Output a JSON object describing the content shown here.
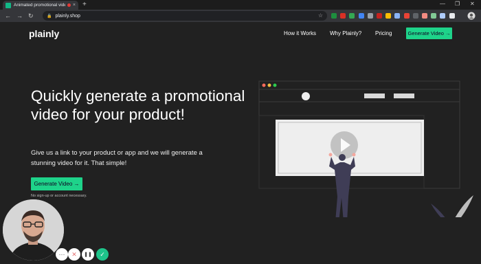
{
  "browser": {
    "tab_title": "Animated promotional video",
    "tab_close": "×",
    "new_tab": "+",
    "back": "←",
    "forward": "→",
    "reload": "↻",
    "url": "plainly.shop",
    "window_min": "—",
    "window_max": "❐",
    "window_close": "✕",
    "extension_colors": [
      "#1e8e3e",
      "#d93025",
      "#34a853",
      "#4285f4",
      "#9aa0a6",
      "#c5221f",
      "#fbbc04",
      "#8ab4f8",
      "#ea4335",
      "#5f6368",
      "#f28b82",
      "#81c995",
      "#aecbfa",
      "#e8eaed"
    ]
  },
  "site": {
    "logo": "plainly",
    "nav": [
      "How it Works",
      "Why Plainly?",
      "Pricing"
    ],
    "cta_top": "Generate Video →",
    "headline": "Quickly generate a promotional video for your product!",
    "subtext": "Give us a link to your product or app and we will generate a stunning video for it. That simple!",
    "cta_main": "Generate Video →",
    "note": "No sign-up or account necessary."
  },
  "recorder": {
    "controls": [
      {
        "icon": "more-icon",
        "glyph": "···"
      },
      {
        "icon": "cancel-icon",
        "glyph": "✕"
      },
      {
        "icon": "pause-icon",
        "glyph": "❚❚"
      },
      {
        "icon": "check-icon",
        "glyph": "✓"
      }
    ]
  },
  "colors": {
    "accent": "#1ed38a",
    "page_bg": "#212121",
    "figure": "#3f3d56"
  }
}
